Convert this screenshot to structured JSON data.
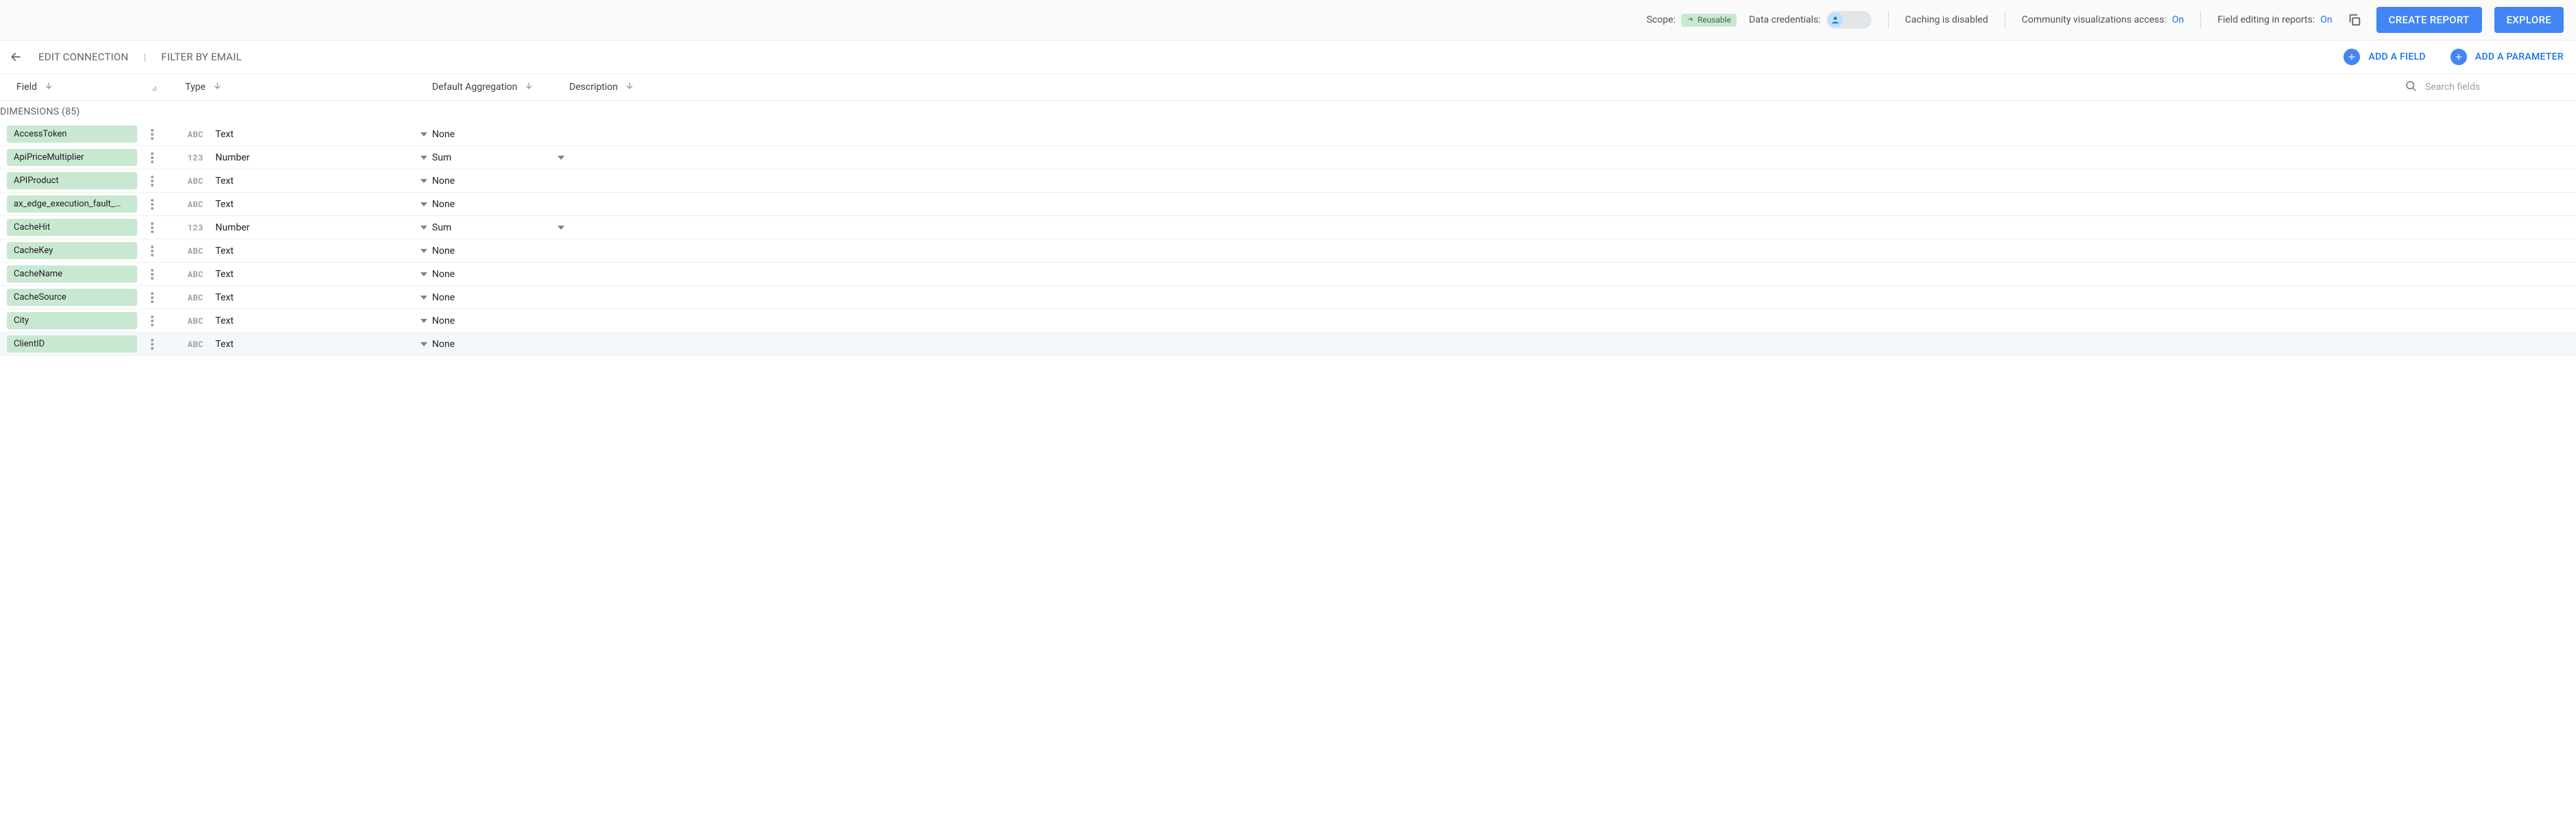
{
  "topbar": {
    "scope_label": "Scope:",
    "scope_chip": "Reusable",
    "data_cred_label": "Data credentials:",
    "caching_text": "Caching is disabled",
    "community_label": "Community visualizations access:",
    "community_value": "On",
    "field_edit_label": "Field editing in reports:",
    "field_edit_value": "On",
    "create_report": "CREATE REPORT",
    "explore": "EXPLORE"
  },
  "nav": {
    "edit_connection": "EDIT CONNECTION",
    "filter_by_email": "FILTER BY EMAIL",
    "add_field": "ADD A FIELD",
    "add_parameter": "ADD A PARAMETER"
  },
  "columns": {
    "field": "Field",
    "type": "Type",
    "agg": "Default Aggregation",
    "desc": "Description",
    "search_placeholder": "Search fields"
  },
  "section": {
    "dimensions_label": "DIMENSIONS (85)"
  },
  "type_icons": {
    "text": "ABC",
    "number": "123"
  },
  "rows": [
    {
      "name": "AccessToken",
      "type": "text",
      "type_label": "Text",
      "agg": "None",
      "agg_dd": false,
      "hover": false
    },
    {
      "name": "ApiPriceMultiplier",
      "type": "number",
      "type_label": "Number",
      "agg": "Sum",
      "agg_dd": true,
      "hover": false
    },
    {
      "name": "APIProduct",
      "type": "text",
      "type_label": "Text",
      "agg": "None",
      "agg_dd": false,
      "hover": false
    },
    {
      "name": "ax_edge_execution_fault_…",
      "type": "text",
      "type_label": "Text",
      "agg": "None",
      "agg_dd": false,
      "hover": false
    },
    {
      "name": "CacheHit",
      "type": "number",
      "type_label": "Number",
      "agg": "Sum",
      "agg_dd": true,
      "hover": false
    },
    {
      "name": "CacheKey",
      "type": "text",
      "type_label": "Text",
      "agg": "None",
      "agg_dd": false,
      "hover": false
    },
    {
      "name": "CacheName",
      "type": "text",
      "type_label": "Text",
      "agg": "None",
      "agg_dd": false,
      "hover": false
    },
    {
      "name": "CacheSource",
      "type": "text",
      "type_label": "Text",
      "agg": "None",
      "agg_dd": false,
      "hover": false
    },
    {
      "name": "City",
      "type": "text",
      "type_label": "Text",
      "agg": "None",
      "agg_dd": false,
      "hover": false
    },
    {
      "name": "ClientID",
      "type": "text",
      "type_label": "Text",
      "agg": "None",
      "agg_dd": false,
      "hover": true
    }
  ]
}
